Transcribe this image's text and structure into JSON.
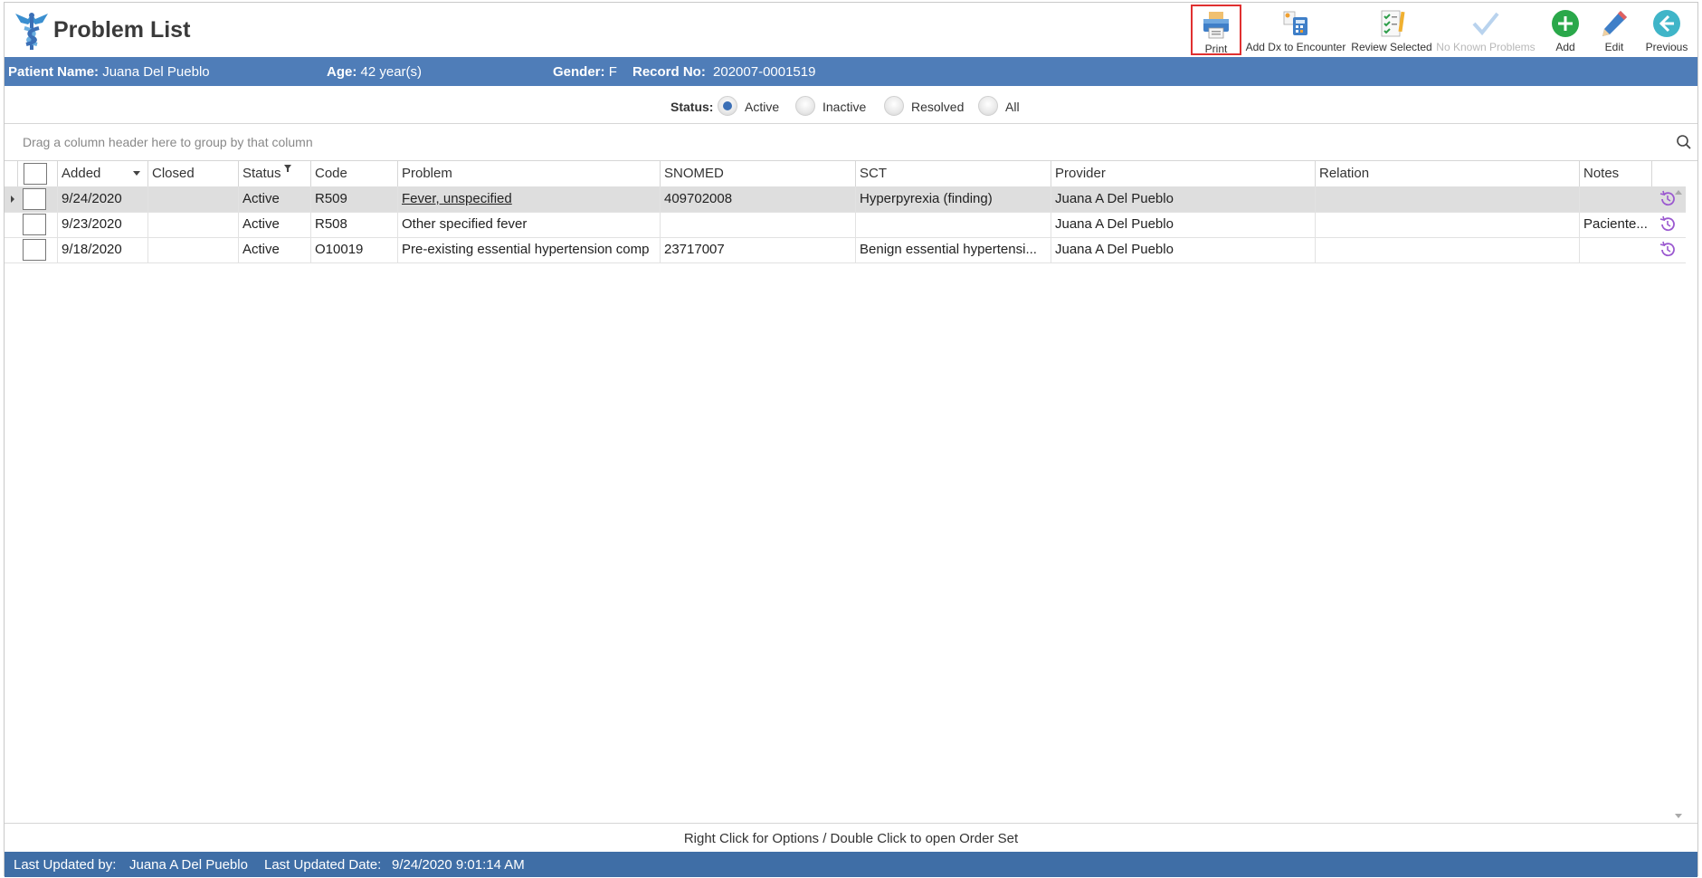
{
  "app": {
    "title": "Problem List"
  },
  "toolbar": {
    "print": "Print",
    "add_dx": "Add Dx to Encounter",
    "review_selected": "Review Selected",
    "no_known_problems": "No Known Problems",
    "add": "Add",
    "edit": "Edit",
    "previous": "Previous"
  },
  "patient": {
    "name_label": "Patient Name:",
    "name": "Juana Del Pueblo",
    "age_label": "Age:",
    "age": "42 year(s)",
    "gender_label": "Gender:",
    "gender": "F",
    "record_label": "Record No:",
    "record": "202007-0001519"
  },
  "status_filter": {
    "label": "Status:",
    "options": [
      {
        "label": "Active",
        "checked": true
      },
      {
        "label": "Inactive",
        "checked": false
      },
      {
        "label": "Resolved",
        "checked": false
      },
      {
        "label": "All",
        "checked": false
      }
    ]
  },
  "group_panel": {
    "text": "Drag a column header here to group by that column"
  },
  "grid": {
    "columns": [
      "Added",
      "Closed",
      "Status",
      "Code",
      "Problem",
      "SNOMED",
      "SCT",
      "Provider",
      "Relation",
      "Notes"
    ],
    "rows": [
      {
        "added": "9/24/2020",
        "closed": "",
        "status": "Active",
        "code": "R509",
        "problem": "Fever, unspecified",
        "snomed": "409702008",
        "sct": "Hyperpyrexia (finding)",
        "provider": "Juana A Del Pueblo",
        "relation": "",
        "notes": ""
      },
      {
        "added": "9/23/2020",
        "closed": "",
        "status": "Active",
        "code": "R508",
        "problem": "Other specified fever",
        "snomed": "",
        "sct": "",
        "provider": "Juana A Del Pueblo",
        "relation": "",
        "notes": "Paciente..."
      },
      {
        "added": "9/18/2020",
        "closed": "",
        "status": "Active",
        "code": "O10019",
        "problem": "Pre-existing essential hypertension comp",
        "snomed": "23717007",
        "sct": "Benign essential hypertensi...",
        "provider": "Juana A Del Pueblo",
        "relation": "",
        "notes": ""
      }
    ]
  },
  "footer": {
    "hint": "Right Click for Options / Double Click to open Order Set",
    "last_updated_by_label": "Last Updated by:",
    "last_updated_by": "Juana A Del Pueblo",
    "last_updated_date_label": "Last Updated Date:",
    "last_updated_date": "9/24/2020 9:01:14 AM"
  },
  "colors": {
    "header_bar": "#4f7db8",
    "status_bar": "#3f6ea6",
    "accent": "#3b6fb6",
    "history_icon": "#9b59d0"
  }
}
